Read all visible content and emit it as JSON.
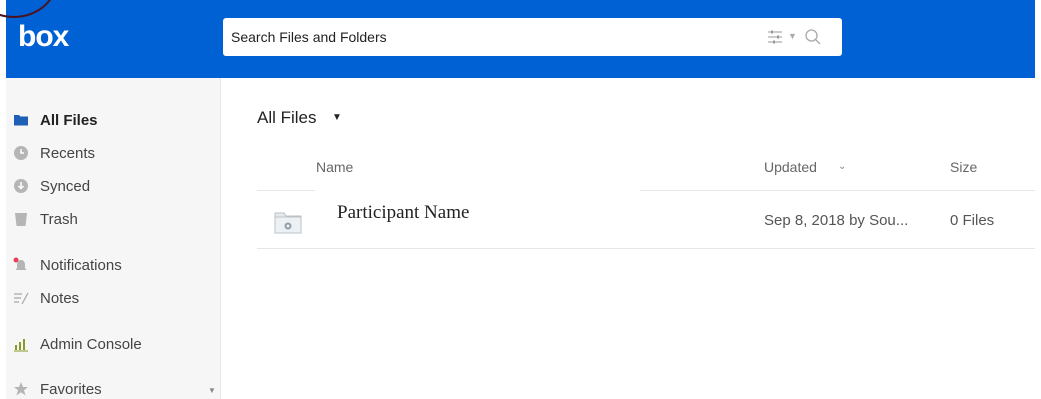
{
  "header": {
    "logo": "box",
    "search_placeholder": "Search Files and Folders",
    "brand_color": "#0061d5"
  },
  "sidebar": {
    "items": [
      {
        "label": "All Files",
        "icon": "folder-icon",
        "active": true
      },
      {
        "label": "Recents",
        "icon": "clock-icon"
      },
      {
        "label": "Synced",
        "icon": "download-circle-icon"
      },
      {
        "label": "Trash",
        "icon": "trash-icon"
      },
      {
        "label": "Notifications",
        "icon": "bell-icon"
      },
      {
        "label": "Notes",
        "icon": "notes-icon"
      },
      {
        "label": "Admin Console",
        "icon": "bar-chart-icon"
      },
      {
        "label": "Favorites",
        "icon": "star-icon"
      }
    ]
  },
  "main": {
    "title": "All Files",
    "columns": {
      "name": "Name",
      "updated": "Updated",
      "size": "Size"
    },
    "rows": [
      {
        "name": "Participant Name",
        "updated": "Sep 8, 2018 by Sou...",
        "size": "0 Files"
      }
    ]
  }
}
